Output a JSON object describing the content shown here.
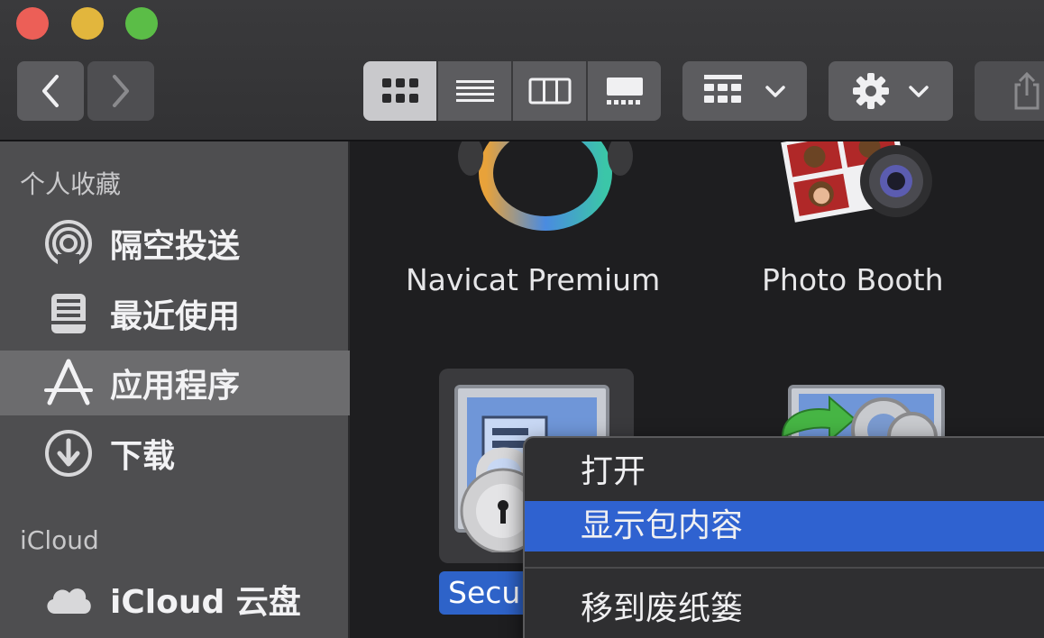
{
  "toolbar": {
    "view_modes": [
      "icon-view",
      "list-view",
      "column-view",
      "gallery-view"
    ],
    "active_view": "icon-view"
  },
  "sidebar": {
    "favorites_header": "个人收藏",
    "favorites": [
      {
        "label": "隔空投送",
        "icon": "airdrop-icon"
      },
      {
        "label": "最近使用",
        "icon": "recents-icon"
      },
      {
        "label": "应用程序",
        "icon": "applications-icon",
        "selected": true
      },
      {
        "label": "下载",
        "icon": "downloads-icon"
      }
    ],
    "icloud_header": "iCloud",
    "icloud": [
      {
        "label": "iCloud 云盘",
        "icon": "cloud-icon"
      }
    ]
  },
  "content": {
    "apps": [
      {
        "name": "Navicat Premium",
        "icon": "navicat-icon"
      },
      {
        "name": "Photo Booth",
        "icon": "photo-booth-icon"
      },
      {
        "name": "Secu",
        "icon": "lock-app-icon",
        "selected": true
      },
      {
        "name": "",
        "icon": "migration-app-icon"
      }
    ]
  },
  "context_menu": {
    "items": [
      {
        "label": "打开"
      },
      {
        "label": "显示包内容",
        "highlighted": true
      },
      {
        "label": "移到废纸篓"
      }
    ]
  },
  "colors": {
    "accent": "#2f62d0",
    "sidebar": "#4e4e50",
    "content_bg": "#1e1e20"
  }
}
